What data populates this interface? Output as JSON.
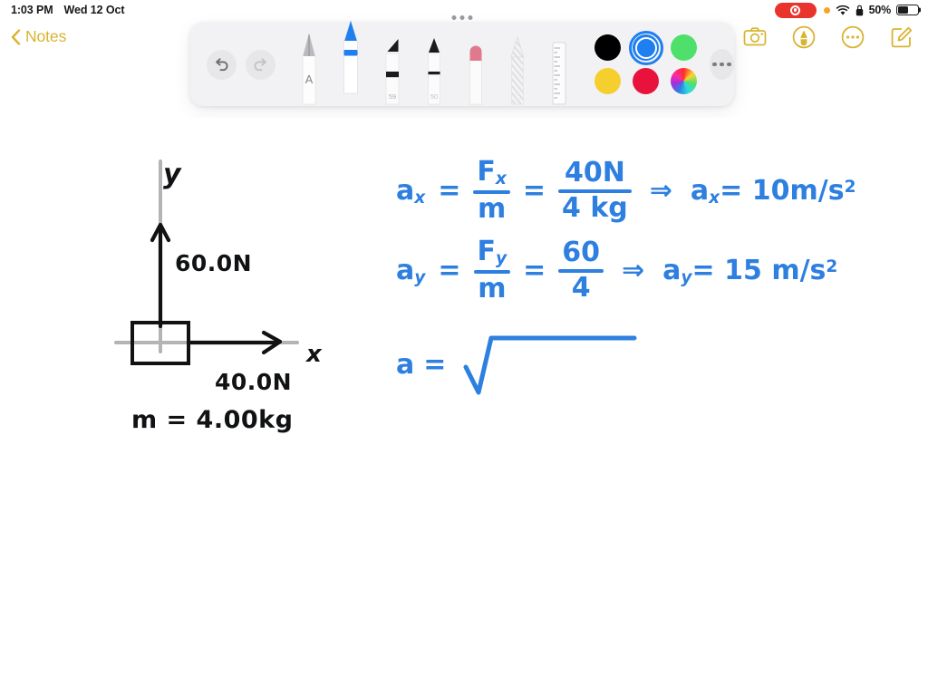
{
  "statusbar": {
    "time": "1:03 PM",
    "date": "Wed 12 Oct",
    "battery_percent": "50%",
    "recording_icon": "screen-recording-indicator",
    "privacy_dot": "microphone-in-use-dot",
    "wifi_icon": "wifi-icon",
    "lock_icon": "orientation-lock-icon",
    "battery_icon": "battery-icon",
    "battery_level": 50
  },
  "navigation": {
    "back_label": "Notes",
    "back_icon": "chevron-left-icon"
  },
  "top_actions": [
    {
      "name": "camera-button",
      "icon": "camera-icon"
    },
    {
      "name": "markup-button",
      "icon": "markup-pen-circle-icon"
    },
    {
      "name": "more-options-button",
      "icon": "ellipsis-circle-icon"
    },
    {
      "name": "compose-button",
      "icon": "compose-icon"
    }
  ],
  "toolbar": {
    "grip": "drag-handle",
    "undo_label": "Undo",
    "redo_label": "Redo",
    "undo_icon": "undo-arrow-icon",
    "redo_icon": "redo-arrow-icon",
    "undo_enabled": true,
    "redo_enabled": false,
    "more_tools_label": "More",
    "tools": [
      {
        "name": "fountain-pen-tool",
        "label": "A",
        "selected": false,
        "size_label": ""
      },
      {
        "name": "pen-tool",
        "label": "Pen",
        "selected": true,
        "size_label": ""
      },
      {
        "name": "highlighter-tool",
        "label": "Highlighter",
        "selected": false,
        "size_label": "59"
      },
      {
        "name": "pencil-tool",
        "label": "Pencil",
        "selected": false,
        "size_label": "50"
      },
      {
        "name": "eraser-tool",
        "label": "Eraser",
        "selected": false,
        "size_label": ""
      },
      {
        "name": "crayon-tool",
        "label": "Crayon",
        "selected": false,
        "size_label": ""
      },
      {
        "name": "ruler-tool",
        "label": "Ruler",
        "selected": false,
        "size_label": ""
      }
    ],
    "colors": [
      {
        "name": "black",
        "hex": "#000000",
        "selected": false
      },
      {
        "name": "blue",
        "hex": "#1d7ff0",
        "selected": true
      },
      {
        "name": "green",
        "hex": "#4ee06a",
        "selected": false
      },
      {
        "name": "yellow",
        "hex": "#f5cf2e",
        "selected": false
      },
      {
        "name": "red",
        "hex": "#e8123c",
        "selected": false
      },
      {
        "name": "spectrum",
        "hex": "rainbow",
        "selected": false
      }
    ]
  },
  "note": {
    "diagram": {
      "y_axis_label": "y",
      "x_axis_label": "x",
      "vertical_force_label": "60.0N",
      "horizontal_force_label": "40.0N",
      "mass_label": "m = 4.00kg",
      "ink_color": "#111214",
      "axis_color": "#b4b4b6"
    },
    "work": {
      "ink_color": "#2d7fe0",
      "line1": {
        "lhs": "a",
        "lhs_sub": "x",
        "eq1": "=",
        "frac1_num": "F",
        "frac1_num_sub": "x",
        "frac1_den": "m",
        "eq2": "=",
        "frac2_num": "40N",
        "frac2_den": "4 kg",
        "implies": "⇒",
        "result": "a",
        "result_sub": "x",
        "result_eq": "= 10m/s",
        "result_sup": "2"
      },
      "line2": {
        "lhs": "a",
        "lhs_sub": "y",
        "eq1": "=",
        "frac1_num": "F",
        "frac1_num_sub": "y",
        "frac1_den": "m",
        "eq2": "=",
        "frac2_num": "60",
        "frac2_den": "4",
        "implies": "⇒",
        "result": "a",
        "result_sub": "y",
        "result_eq": "= 15 m/s",
        "result_sup": "2"
      },
      "line3": {
        "lhs": "a",
        "eq1": "=",
        "radical": "square-root-empty"
      }
    }
  }
}
